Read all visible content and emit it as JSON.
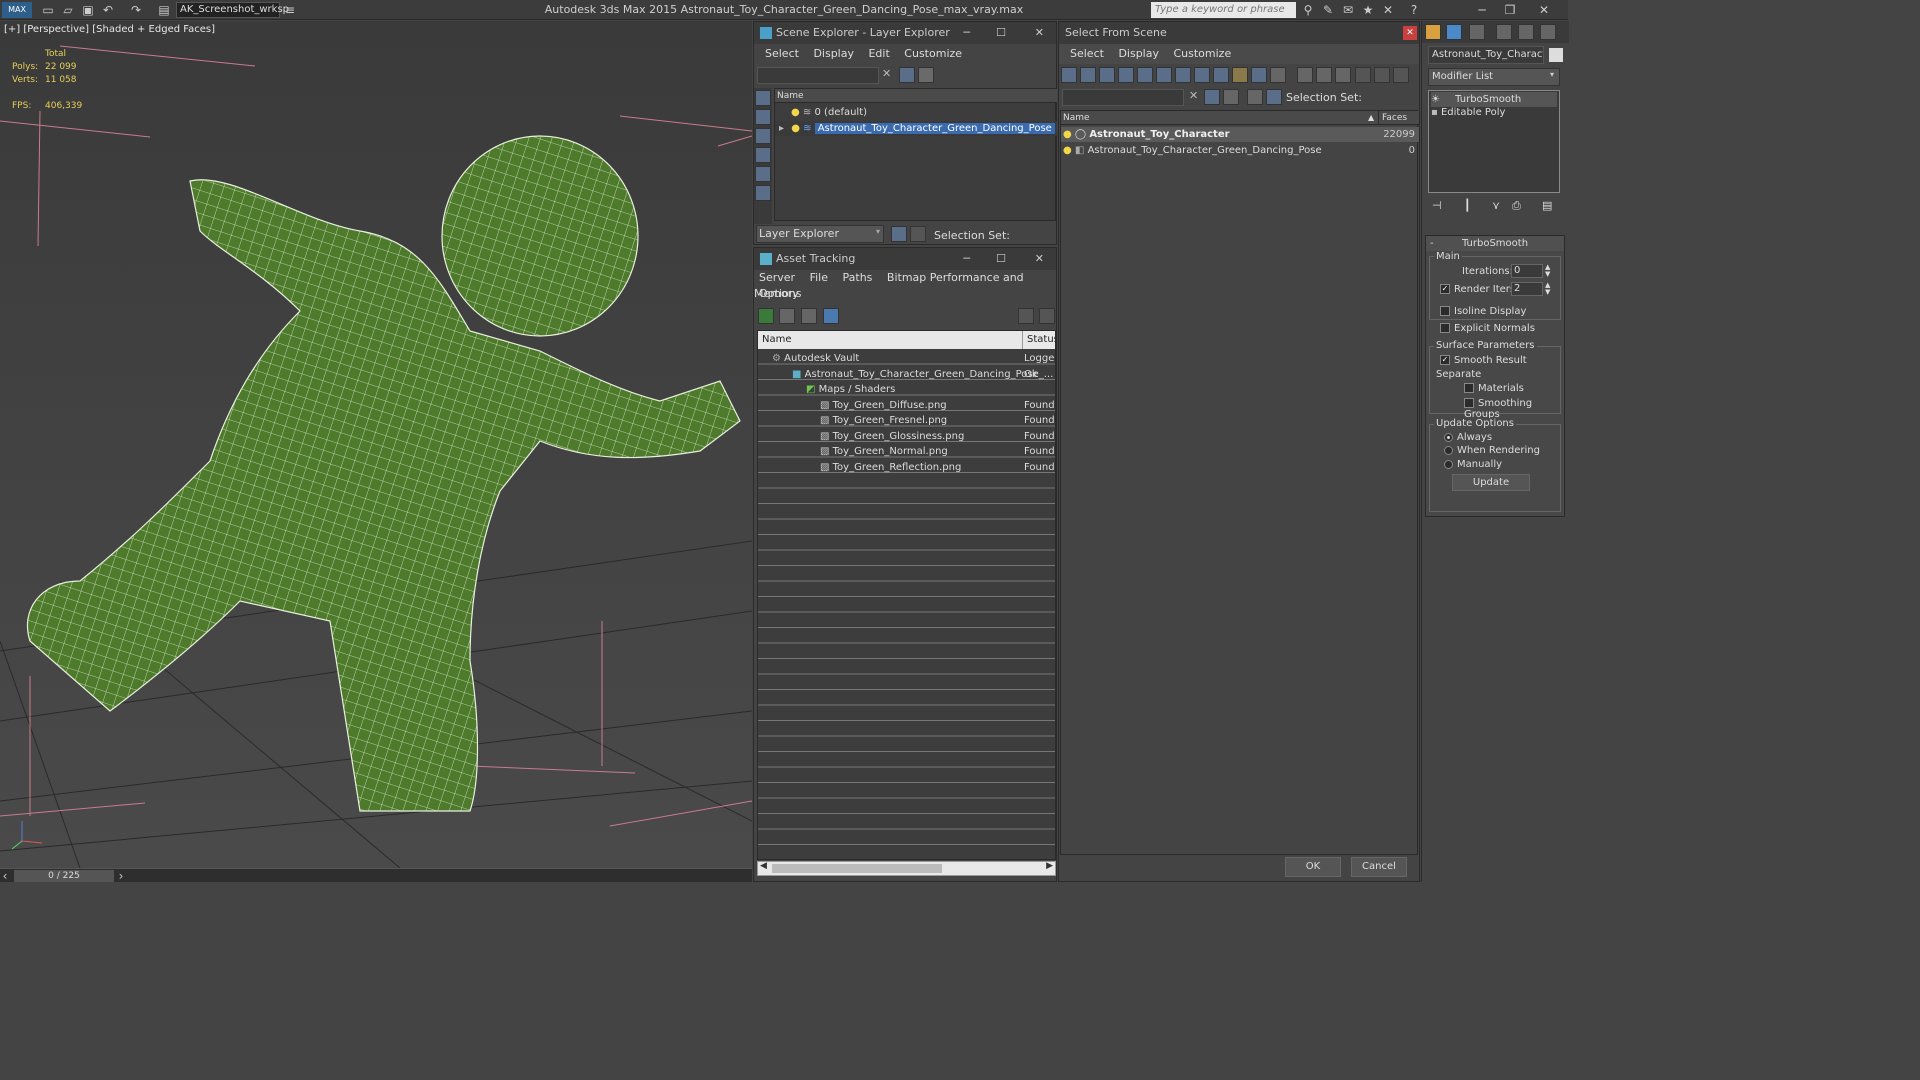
{
  "app": {
    "title": "Autodesk 3ds Max  2015     Astronaut_Toy_Character_Green_Dancing_Pose_max_vray.max",
    "workspace": "AK_Screenshot_wrksp",
    "search_placeholder": "Type a keyword or phrase"
  },
  "viewport": {
    "label": "[+] [Perspective] [Shaded + Edged Faces]",
    "total_label": "Total",
    "polys_label": "Polys:",
    "polys": "22 099",
    "verts_label": "Verts:",
    "verts": "11 058",
    "fps_label": "FPS:",
    "fps": "406,339"
  },
  "timeline": {
    "position": "0 / 225"
  },
  "scene_explorer": {
    "title": "Scene Explorer - Layer Explorer",
    "menu": [
      "Select",
      "Display",
      "Edit",
      "Customize"
    ],
    "column": "Name",
    "rows": [
      "0 (default)",
      "Astronaut_Toy_Character_Green_Dancing_Pose"
    ],
    "footer_dd": "Layer Explorer",
    "selection_set": "Selection Set:"
  },
  "asset_tracking": {
    "title": "Asset Tracking",
    "menu": [
      "Server",
      "File",
      "Paths",
      "Bitmap Performance and Memory"
    ],
    "menu2": "Options",
    "col_name": "Name",
    "col_status": "Status",
    "rows": [
      {
        "name": "Autodesk Vault",
        "status": "Logged"
      },
      {
        "name": "Astronaut_Toy_Character_Green_Dancing_Pose_...",
        "status": "Ok"
      },
      {
        "name": "Maps / Shaders",
        "status": ""
      },
      {
        "name": "Toy_Green_Diffuse.png",
        "status": "Found"
      },
      {
        "name": "Toy_Green_Fresnel.png",
        "status": "Found"
      },
      {
        "name": "Toy_Green_Glossiness.png",
        "status": "Found"
      },
      {
        "name": "Toy_Green_Normal.png",
        "status": "Found"
      },
      {
        "name": "Toy_Green_Reflection.png",
        "status": "Found"
      }
    ]
  },
  "select_from_scene": {
    "title": "Select From Scene",
    "menu": [
      "Select",
      "Display",
      "Customize"
    ],
    "selection_set": "Selection Set:",
    "col_name": "Name",
    "col_faces": "Faces",
    "rows": [
      {
        "name": "Astronaut_Toy_Character",
        "faces": "22099"
      },
      {
        "name": "Astronaut_Toy_Character_Green_Dancing_Pose",
        "faces": "0"
      }
    ],
    "ok": "OK",
    "cancel": "Cancel"
  },
  "command_panel": {
    "object_name": "Astronaut_Toy_Character",
    "modifier_list": "Modifier List",
    "stack": [
      "TurboSmooth",
      "Editable Poly"
    ],
    "rollout_title": "TurboSmooth",
    "main_label": "Main",
    "iterations_label": "Iterations:",
    "iterations": "0",
    "render_iters_label": "Render Iters:",
    "render_iters": "2",
    "isoline": "Isoline Display",
    "explicit_normals": "Explicit Normals",
    "surface_params": "Surface Parameters",
    "smooth_result": "Smooth Result",
    "separate": "Separate",
    "materials": "Materials",
    "smoothing_groups": "Smoothing Groups",
    "update_options": "Update Options",
    "always": "Always",
    "when_rendering": "When Rendering",
    "manually": "Manually",
    "update": "Update"
  }
}
